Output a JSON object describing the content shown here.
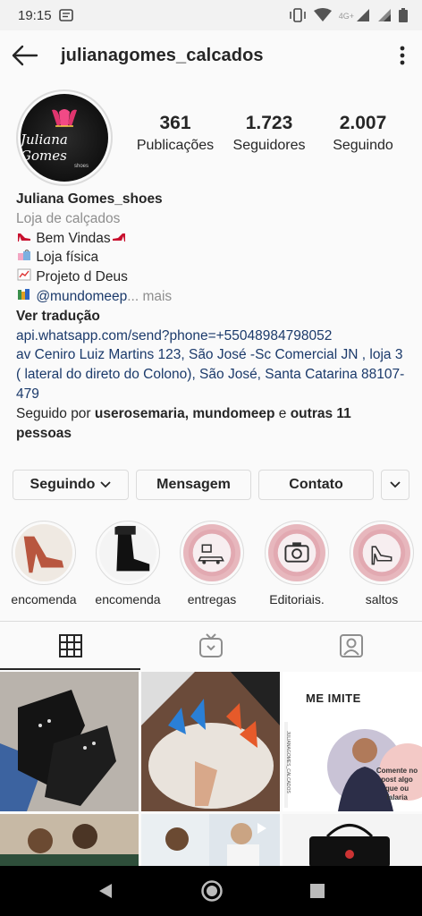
{
  "status_bar": {
    "time": "19:15",
    "network": "4G+"
  },
  "header": {
    "username": "julianagomes_calcados"
  },
  "profile": {
    "avatar_brand": "Juliana Gomes",
    "avatar_sub": "shoes",
    "stats": [
      {
        "value": "361",
        "label": "Publicações"
      },
      {
        "value": "1.723",
        "label": "Seguidores"
      },
      {
        "value": "2.007",
        "label": "Seguindo"
      }
    ]
  },
  "bio": {
    "name": "Juliana Gomes_shoes",
    "category": "Loja de calçados",
    "line1": "Bem Vindas",
    "line2": "Loja física",
    "line3": "Projeto d Deus",
    "line4_mention": "@mundomeep",
    "line4_more": "... mais",
    "translate": "Ver tradução",
    "link": "api.whatsapp.com/send?phone=+55048984798052",
    "address": "av Ceniro  Luiz Martins 123, São José -Sc Comercial JN , loja 3 ( lateral do direto do Colono), São José, Santa Catarina 88107-479",
    "followed_prefix": "Seguido por ",
    "followed_names": "userosemaria, mundomeep",
    "followed_mid": " e ",
    "followed_others": "outras 11 pessoas"
  },
  "actions": {
    "following": "Seguindo",
    "message": "Mensagem",
    "contact": "Contato"
  },
  "highlights": [
    {
      "label": "encomenda"
    },
    {
      "label": "encomenda"
    },
    {
      "label": "entregas"
    },
    {
      "label": "Editoriais."
    },
    {
      "label": "saltos"
    }
  ],
  "grid": {
    "post3_title": "ME IMITE",
    "post3_side": "JULIANAGOMES_CALCADOS",
    "post3_bubble": "Comente no post algo que ou falaria"
  },
  "colors": {
    "link": "#1b3a6b",
    "muted": "#8e8e8e",
    "border": "#dbdbdb"
  }
}
